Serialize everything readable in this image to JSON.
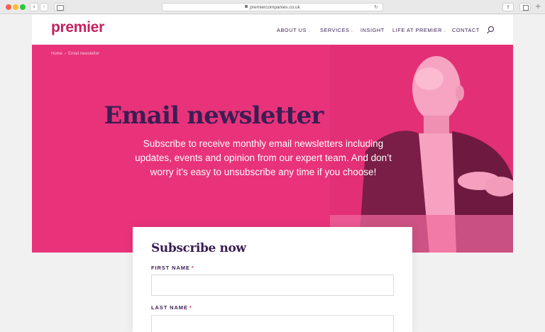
{
  "browser": {
    "url": "premiercompanies.co.uk",
    "back_glyph": "‹",
    "forward_glyph": "›",
    "reload_glyph": "↻",
    "share_glyph": "⇪",
    "new_tab_glyph": "+"
  },
  "header": {
    "logo_text": "premier",
    "brand_color": "#c6205f",
    "nav": [
      {
        "label": "ABOUT US",
        "dropdown": true
      },
      {
        "label": "SERVICES",
        "dropdown": true
      },
      {
        "label": "INSIGHT",
        "dropdown": false
      },
      {
        "label": "LIFE AT PREMIER",
        "dropdown": true
      },
      {
        "label": "CONTACT",
        "dropdown": false
      }
    ],
    "nav_chevron": "⌄",
    "search_icon": "search-icon"
  },
  "hero": {
    "background_color": "#e8337a",
    "breadcrumb": {
      "home": "Home",
      "separator": "›",
      "current": "Email newsletter"
    },
    "title": "Email newsletter",
    "intro": "Subscribe to receive monthly email newsletters including updates, events and opinion from our expert team. And don’t worry it’s easy to unsubscribe any time if you choose!"
  },
  "form": {
    "title": "Subscribe now",
    "fields": [
      {
        "label": "FIRST NAME",
        "required_mark": "*",
        "value": "",
        "placeholder": ""
      },
      {
        "label": "LAST NAME",
        "required_mark": "*",
        "value": "",
        "placeholder": ""
      }
    ]
  }
}
